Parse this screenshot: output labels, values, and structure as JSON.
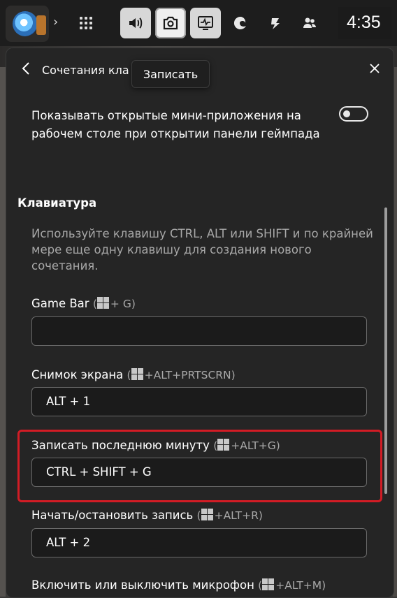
{
  "topbar": {
    "time": "4:35",
    "buttons": [
      "volume",
      "capture",
      "performance"
    ]
  },
  "panel": {
    "title": "Сочетания кла",
    "tooltip": "Записать"
  },
  "settings": {
    "toggle_text": "Показывать открытые мини-приложения на рабочем столе при открытии панели геймпада",
    "toggle_state": "off",
    "section_title": "Клавиатура",
    "hint": "Используйте клавишу CTRL, ALT или SHIFT и по крайней мере еще одну клавишу для создания нового сочетания.",
    "shortcuts": [
      {
        "label": "Game Bar",
        "default": "+ G)",
        "value": ""
      },
      {
        "label": "Снимок экрана",
        "default": "+ALT+PRTSCRN)",
        "value": "ALT + 1"
      },
      {
        "label": "Записать последнюю минуту",
        "default": "+ALT+G)",
        "value": "CTRL + SHIFT + G"
      },
      {
        "label": "Начать/остановить запись",
        "default": "+ALT+R)",
        "value": "ALT + 2"
      },
      {
        "label": "Включить или выключить микрофон",
        "default": "+ALT+M)",
        "value": ""
      }
    ]
  },
  "colors": {
    "highlight": "#d21c25",
    "panel_bg": "#252525"
  }
}
